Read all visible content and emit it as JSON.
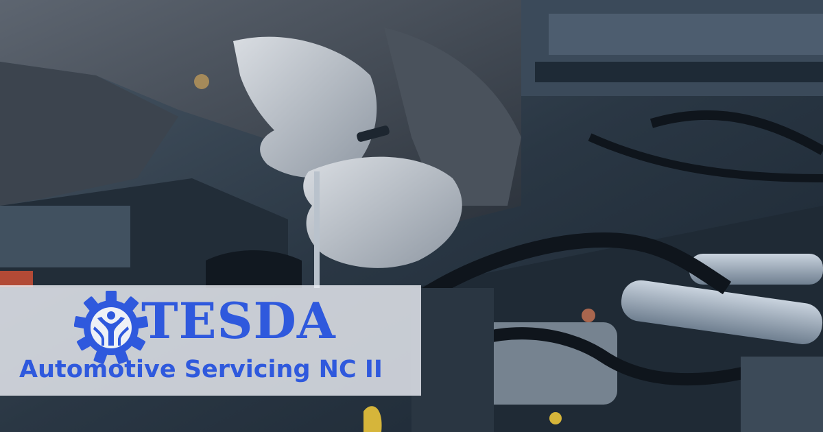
{
  "banner": {
    "brand_name": "TESDA",
    "course_title": "Automotive Servicing NC II",
    "brand_color": "#2f59dd",
    "banner_color": "#ebeef4"
  },
  "logo": {
    "icon": "tesda-gear-emblem-icon"
  },
  "photo": {
    "subject": "mechanic-hands-engine-bay"
  }
}
